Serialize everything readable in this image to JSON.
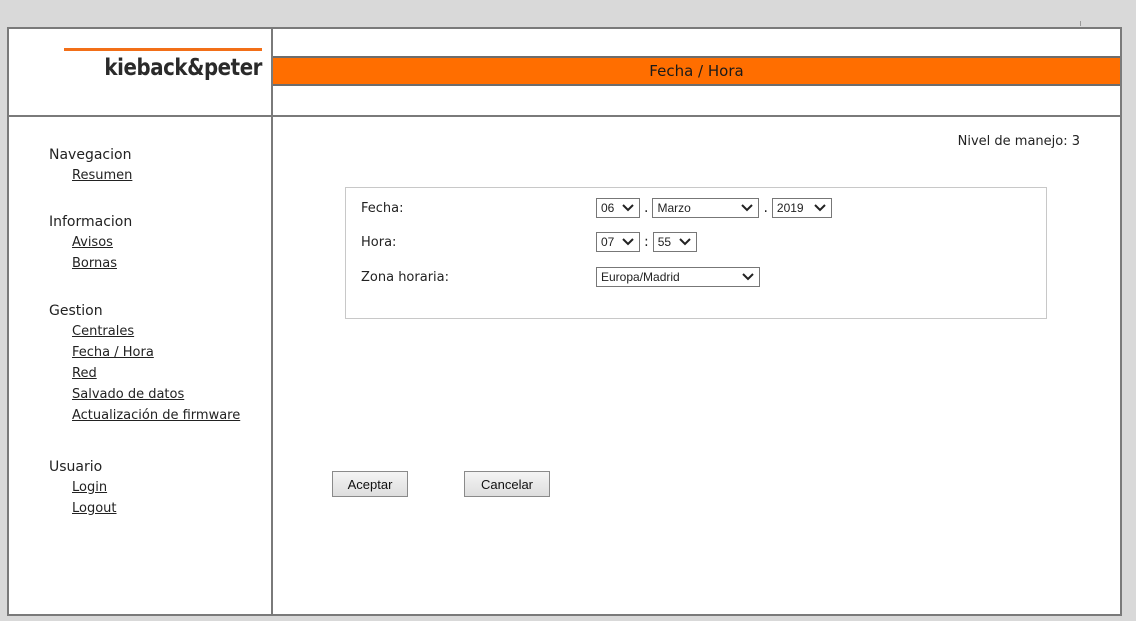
{
  "header": {
    "logo_text": "kieback&peter",
    "page_title": "Fecha / Hora"
  },
  "level": "Nivel de manejo: 3",
  "sidebar": {
    "groups": [
      {
        "title": "Navegacion",
        "links": [
          "Resumen"
        ]
      },
      {
        "title": "Informacion",
        "links": [
          "Avisos",
          "Bornas"
        ]
      },
      {
        "title": "Gestion",
        "links": [
          "Centrales",
          "Fecha / Hora",
          "Red",
          "Salvado de datos",
          "Actualización de firmware"
        ]
      },
      {
        "title": "Usuario",
        "links": [
          "Login",
          "Logout"
        ]
      }
    ]
  },
  "form": {
    "fecha": {
      "label": "Fecha:",
      "day": "06",
      "month": "Marzo",
      "year": "2019",
      "sep1": ".",
      "sep2": "."
    },
    "hora": {
      "label": "Hora:",
      "hour": "07",
      "minute": "55",
      "sep": ":"
    },
    "zona": {
      "label": "Zona horaria:",
      "value": "Europa/Madrid"
    }
  },
  "buttons": {
    "accept": "Aceptar",
    "cancel": "Cancelar"
  },
  "colors": {
    "accent": "#ff6e00",
    "logo_line": "#f26f18"
  }
}
